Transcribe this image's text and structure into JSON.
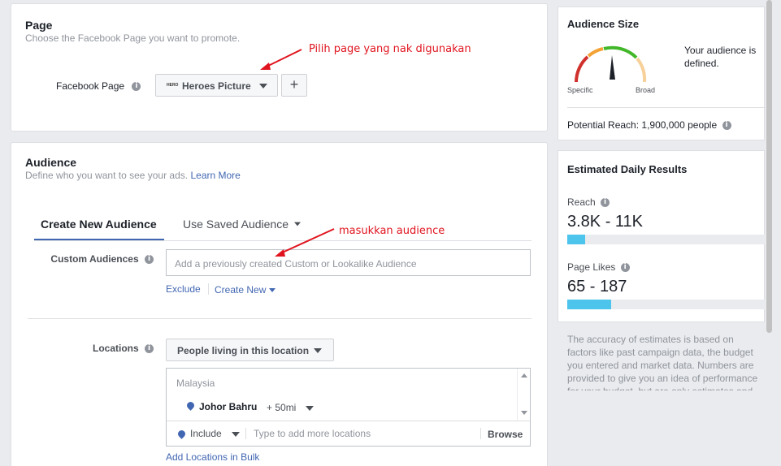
{
  "page_section": {
    "title": "Page",
    "subtitle": "Choose the Facebook Page you want to promote.",
    "field_label": "Facebook Page",
    "page_dropdown": "Heroes Picture",
    "page_logo_text": "HERO",
    "add_button": "+",
    "annotation": "Pilih page yang nak digunakan"
  },
  "audience_section": {
    "title": "Audience",
    "subtitle": "Define who you want to see your ads.",
    "learn_more": "Learn More",
    "tabs": [
      "Create New Audience",
      "Use Saved Audience"
    ],
    "active_tab": 0,
    "custom_audiences_label": "Custom Audiences",
    "custom_audiences_placeholder": "Add a previously created Custom or Lookalike Audience",
    "exclude_link": "Exclude",
    "create_new_link": "Create New",
    "annotation": "masukkan audience",
    "locations_label": "Locations",
    "location_type": "People living in this location",
    "country": "Malaysia",
    "city": "Johor Bahru",
    "radius": "+ 50mi",
    "include_dropdown": "Include",
    "locations_placeholder": "Type to add more locations",
    "browse": "Browse",
    "bulk_link": "Add Locations in Bulk"
  },
  "audience_size": {
    "title": "Audience Size",
    "status": "Your audience is defined.",
    "gauge_left": "Specific",
    "gauge_right": "Broad",
    "potential_reach": "Potential Reach: 1,900,000 people"
  },
  "daily_results": {
    "title": "Estimated Daily Results",
    "reach_label": "Reach",
    "reach_value": "3.8K - 11K",
    "reach_fill": 0.09,
    "likes_label": "Page Likes",
    "likes_value": "65 - 187",
    "likes_fill": 0.22,
    "disclaimer": "The accuracy of estimates is based on factors like past campaign data, the budget you entered and market data. Numbers are provided to give you an idea of performance for your budget, but are only estimates and"
  },
  "colors": {
    "accent": "#4267b2",
    "bar": "#4cc4ec",
    "annotation": "#e0141e"
  }
}
